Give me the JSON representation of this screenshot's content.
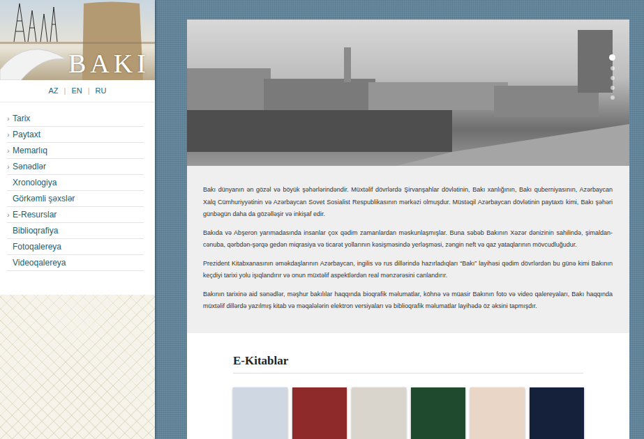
{
  "logo": {
    "title": "BAKI"
  },
  "languages": {
    "separator": "|",
    "items": [
      {
        "label": "AZ"
      },
      {
        "label": "EN"
      },
      {
        "label": "RU"
      }
    ]
  },
  "menu": {
    "marker": "›",
    "items": [
      {
        "label": "Tarix",
        "expandable": true
      },
      {
        "label": "Paytaxt",
        "expandable": true
      },
      {
        "label": "Memarlıq",
        "expandable": true
      },
      {
        "label": "Sənədlər",
        "expandable": true
      },
      {
        "label": "Xronologiya",
        "expandable": false
      },
      {
        "label": "Görkəmli şəxslər",
        "expandable": false
      },
      {
        "label": "E-Resurslar",
        "expandable": true
      },
      {
        "label": "Biblioqrafiya",
        "expandable": false
      },
      {
        "label": "Fotoqalereya",
        "expandable": false
      },
      {
        "label": "Videoqalereya",
        "expandable": false
      }
    ]
  },
  "slider": {
    "dots": [
      {
        "selected": true
      },
      {
        "selected": false
      },
      {
        "selected": false
      },
      {
        "selected": false
      },
      {
        "selected": false
      }
    ]
  },
  "intro": {
    "paragraphs": [
      "Bakı dünyanın ən gözəl və böyük şəhərlərindəndir. Müxtəlif dövrlərdə Şirvanşahlar dövlətinin, Bakı xanlığının, Bakı quberniyasının, Azərbaycan Xalq Cümhuriyyətinin və Azərbaycan Sovet Sosialist Respublikasının mərkəzi olmuşdur. Müstəqil Azərbaycan dövlətinin paytaxtı kimi, Bakı şəhəri günbəgün daha da gözəlləşir və inkişaf edir.",
      "Bakıda və Abşeron yarımadasında insanlar çox qədim zamanlardan məskunlaşmışlar. Buna səbəb Bakının Xəzər dənizinin sahilində, şimaldan-cənuba, qərbdən-şərqə gedən miqrasiya və ticarət yollarının kəsişməsində yerləşməsi, zəngin neft və qaz yataqlarının mövcudluğudur.",
      "Prezident Kitabxanasının əməkdaşlarının Azərbaycan, ingilis və rus dillərində hazırladıqları “Bakı” layihəsi qədim dövrlərdən bu günə kimi Bakının keçdiyi tarixi yolu işıqlandırır və onun müxtəlif aspektlərdən real mənzərəsini canlandırır.",
      "Bakının tarixinə aid sənədlər, məşhur bakılılar haqqında bioqrafik məlumatlar, köhnə və müasir Bakının foto və video qalereyaları, Bakı haqqında müxtəlif dillərdə yazılmış kitab və məqalələrin elektron versiyaları və biblioqrafik məlumatlar layihədə öz əksini tapmışdır."
    ]
  },
  "ebooks": {
    "title": "E-Kitablar",
    "books": [
      {
        "color": "#cfd7e3"
      },
      {
        "color": "#8e2a2a"
      },
      {
        "color": "#d9d5cc"
      },
      {
        "color": "#1f4a2e"
      },
      {
        "color": "#e9d6c6"
      },
      {
        "color": "#15203a"
      }
    ]
  }
}
